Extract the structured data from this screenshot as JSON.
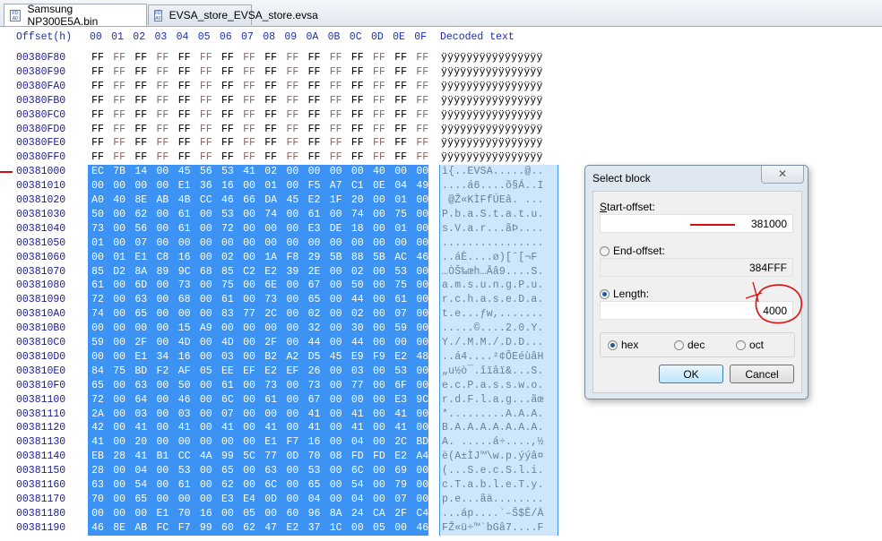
{
  "tabs": [
    {
      "label": "Samsung NP300E5A.bin",
      "active": true
    },
    {
      "label": "EVSA_store_EVSA_store.evsa",
      "active": false
    }
  ],
  "header": {
    "offset_label": "Offset(h)",
    "columns": [
      "00",
      "01",
      "02",
      "03",
      "04",
      "05",
      "06",
      "07",
      "08",
      "09",
      "0A",
      "0B",
      "0C",
      "0D",
      "0E",
      "0F"
    ],
    "decoded_label": "Decoded text"
  },
  "colors": {
    "selection": "#3d93f4",
    "offset_text": "#1c1c99",
    "odd_byte": "#8b6a6a",
    "annotation": "#d01010"
  },
  "rows": [
    {
      "offset": "00380F80",
      "hex": "FF FF FF FF FF FF FF FF FF FF FF FF FF FF FF FF",
      "text": "ÿÿÿÿÿÿÿÿÿÿÿÿÿÿÿÿ",
      "selected": false
    },
    {
      "offset": "00380F90",
      "hex": "FF FF FF FF FF FF FF FF FF FF FF FF FF FF FF FF",
      "text": "ÿÿÿÿÿÿÿÿÿÿÿÿÿÿÿÿ",
      "selected": false
    },
    {
      "offset": "00380FA0",
      "hex": "FF FF FF FF FF FF FF FF FF FF FF FF FF FF FF FF",
      "text": "ÿÿÿÿÿÿÿÿÿÿÿÿÿÿÿÿ",
      "selected": false
    },
    {
      "offset": "00380FB0",
      "hex": "FF FF FF FF FF FF FF FF FF FF FF FF FF FF FF FF",
      "text": "ÿÿÿÿÿÿÿÿÿÿÿÿÿÿÿÿ",
      "selected": false
    },
    {
      "offset": "00380FC0",
      "hex": "FF FF FF FF FF FF FF FF FF FF FF FF FF FF FF FF",
      "text": "ÿÿÿÿÿÿÿÿÿÿÿÿÿÿÿÿ",
      "selected": false
    },
    {
      "offset": "00380FD0",
      "hex": "FF FF FF FF FF FF FF FF FF FF FF FF FF FF FF FF",
      "text": "ÿÿÿÿÿÿÿÿÿÿÿÿÿÿÿÿ",
      "selected": false
    },
    {
      "offset": "00380FE0",
      "hex": "FF FF FF FF FF FF FF FF FF FF FF FF FF FF FF FF",
      "text": "ÿÿÿÿÿÿÿÿÿÿÿÿÿÿÿÿ",
      "selected": false
    },
    {
      "offset": "00380FF0",
      "hex": "FF FF FF FF FF FF FF FF FF FF FF FF FF FF FF FF",
      "text": "ÿÿÿÿÿÿÿÿÿÿÿÿÿÿÿÿ",
      "selected": false
    },
    {
      "offset": "00381000",
      "hex": "EC 7B 14 00 45 56 53 41 02 00 00 00 00 40 00 00",
      "text": "ì{..EVSA.....@..",
      "selected": true
    },
    {
      "offset": "00381010",
      "hex": "00 00 00 00 E1 36 16 00 01 00 F5 A7 C1 0E 04 49",
      "text": "....á6....õ§Á..I",
      "selected": true
    },
    {
      "offset": "00381020",
      "hex": "A0 40 8E AB 4B CC 46 66 DA 45 E2 1F 20 00 01 00",
      "text": " @Ž«KÌFfÚEâ. ...",
      "selected": true
    },
    {
      "offset": "00381030",
      "hex": "50 00 62 00 61 00 53 00 74 00 61 00 74 00 75 00",
      "text": "P.b.a.S.t.a.t.u.",
      "selected": true
    },
    {
      "offset": "00381040",
      "hex": "73 00 56 00 61 00 72 00 00 00 E3 DE 18 00 01 00",
      "text": "s.V.a.r...ãÞ....",
      "selected": true
    },
    {
      "offset": "00381050",
      "hex": "01 00 07 00 00 00 00 00 00 00 00 00 00 00 00 00",
      "text": "................",
      "selected": true
    },
    {
      "offset": "00381060",
      "hex": "00 01 E1 C8 16 00 02 00 1A F8 29 5B 88 5B AC 46",
      "text": "..áÈ....ø)[ˆ[¬F",
      "selected": true
    },
    {
      "offset": "00381070",
      "hex": "85 D2 8A 89 9C 68 85 C2 E2 39 2E 00 02 00 53 00",
      "text": "…ÒŠ‰œh…Ââ9....S.",
      "selected": true
    },
    {
      "offset": "00381080",
      "hex": "61 00 6D 00 73 00 75 00 6E 00 67 00 50 00 75 00",
      "text": "a.m.s.u.n.g.P.u.",
      "selected": true
    },
    {
      "offset": "00381090",
      "hex": "72 00 63 00 68 00 61 00 73 00 65 00 44 00 61 00",
      "text": "r.c.h.a.s.e.D.a.",
      "selected": true
    },
    {
      "offset": "003810A0",
      "hex": "74 00 65 00 00 00 83 77 2C 00 02 00 02 00 07 00",
      "text": "t.e...ƒw,.......",
      "selected": true
    },
    {
      "offset": "003810B0",
      "hex": "00 00 00 00 15 A9 00 00 00 00 32 00 30 00 59 00",
      "text": ".....©....2.0.Y.",
      "selected": true
    },
    {
      "offset": "003810C0",
      "hex": "59 00 2F 00 4D 00 4D 00 2F 00 44 00 44 00 00 00",
      "text": "Y./.M.M./.D.D...",
      "selected": true
    },
    {
      "offset": "003810D0",
      "hex": "00 00 E1 34 16 00 03 00 B2 A2 D5 45 E9 F9 E2 48",
      "text": "..á4....²¢ÕEéùâH",
      "selected": true
    },
    {
      "offset": "003810E0",
      "hex": "84 75 BD F2 AF 05 EE EF E2 EF 26 00 03 00 53 00",
      "text": "„u½ò¯.îïâï&...S.",
      "selected": true
    },
    {
      "offset": "003810F0",
      "hex": "65 00 63 00 50 00 61 00 73 00 73 00 77 00 6F 00",
      "text": "e.c.P.a.s.s.w.o.",
      "selected": true
    },
    {
      "offset": "00381100",
      "hex": "72 00 64 00 46 00 6C 00 61 00 67 00 00 00 E3 9C",
      "text": "r.d.F.l.a.g...ãœ",
      "selected": true
    },
    {
      "offset": "00381110",
      "hex": "2A 00 03 00 03 00 07 00 00 00 41 00 41 00 41 00",
      "text": "*.........A.A.A.",
      "selected": true
    },
    {
      "offset": "00381120",
      "hex": "42 00 41 00 41 00 41 00 41 00 41 00 41 00 41 00",
      "text": "B.A.A.A.A.A.A.A.",
      "selected": true
    },
    {
      "offset": "00381130",
      "hex": "41 00 20 00 00 00 00 00 E1 F7 16 00 04 00 2C BD",
      "text": "A. .....á÷....,½",
      "selected": true
    },
    {
      "offset": "00381140",
      "hex": "EB 28 41 B1 CC 4A 99 5C 77 0D 70 08 FD FD E2 A4",
      "text": "ë(A±ÌJ™\\w.p.ýýâ¤",
      "selected": true
    },
    {
      "offset": "00381150",
      "hex": "28 00 04 00 53 00 65 00 63 00 53 00 6C 00 69 00",
      "text": "(...S.e.c.S.l.i.",
      "selected": true
    },
    {
      "offset": "00381160",
      "hex": "63 00 54 00 61 00 62 00 6C 00 65 00 54 00 79 00",
      "text": "c.T.a.b.l.e.T.y.",
      "selected": true
    },
    {
      "offset": "00381170",
      "hex": "70 00 65 00 00 00 E3 E4 0D 00 04 00 04 00 07 00",
      "text": "p.e...ãä........",
      "selected": true
    },
    {
      "offset": "00381180",
      "hex": "00 00 00 E1 70 16 00 05 00 60 96 8A 24 CA 2F C4",
      "text": "...áp....`–Š$Ê/Ä",
      "selected": true
    },
    {
      "offset": "00381190",
      "hex": "46 8E AB FC F7 99 60 62 47 E2 37 1C 00 05 00 46",
      "text": "FŽ«ü÷™`bGâ7....F",
      "selected": true
    }
  ],
  "dialog": {
    "title": "Select block",
    "close_icon": "close-icon",
    "start_label_u": "S",
    "start_label_rest": "tart-offset:",
    "start_value": "381000",
    "end_label": "End-offset:",
    "end_value": "384FFF",
    "end_selected": false,
    "length_label": "Length:",
    "length_value": "4000",
    "length_selected": true,
    "bases": [
      {
        "label": "hex",
        "selected": true
      },
      {
        "label": "dec",
        "selected": false
      },
      {
        "label": "oct",
        "selected": false
      }
    ],
    "ok_label": "OK",
    "cancel_label": "Cancel"
  }
}
